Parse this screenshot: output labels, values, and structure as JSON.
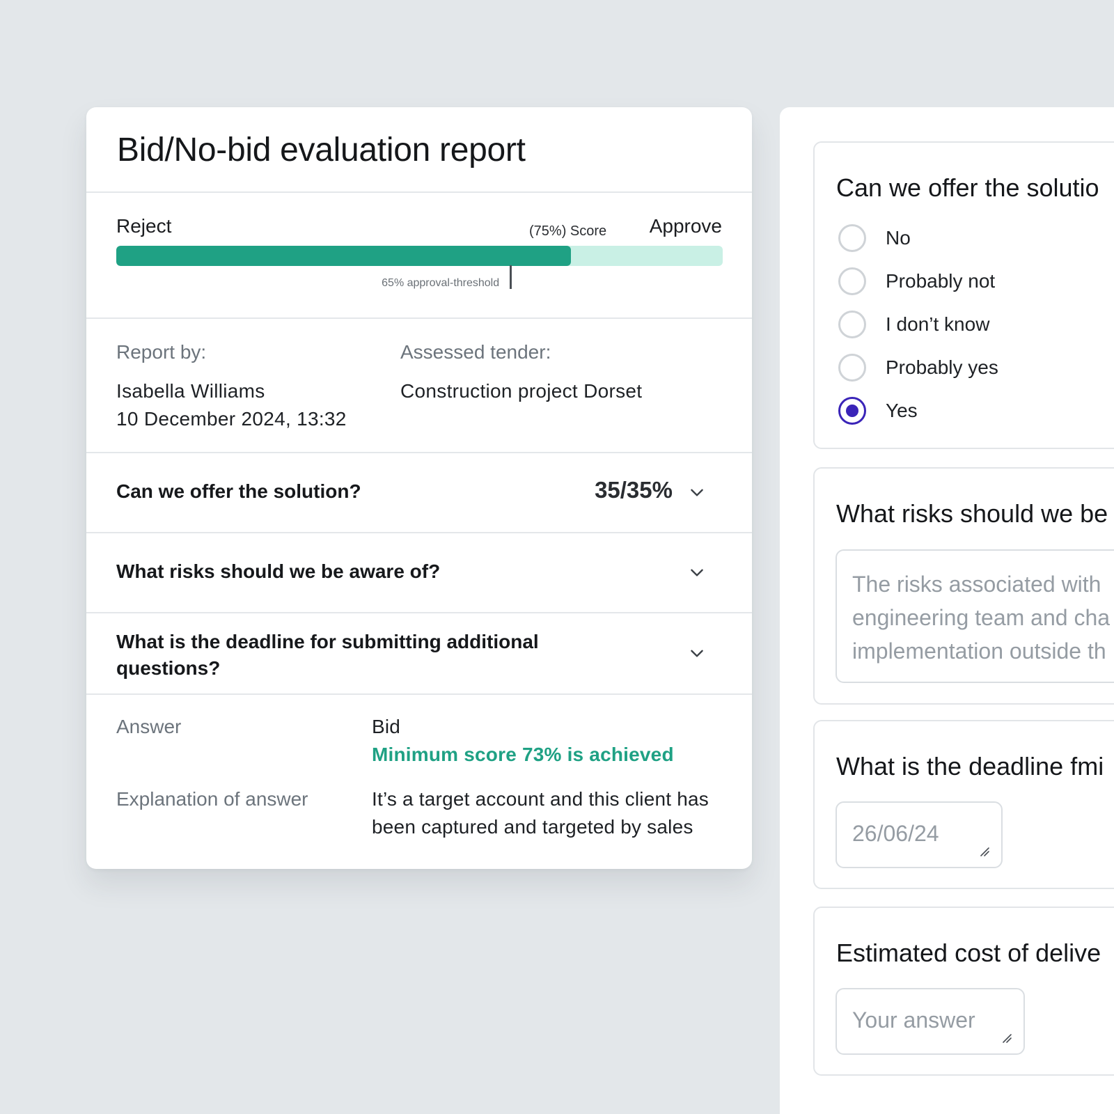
{
  "report": {
    "title": "Bid/No-bid evaluation report",
    "score_bar": {
      "reject_label": "Reject",
      "approve_label": "Approve",
      "score_label": "(75%) Score",
      "score_fraction": 0.75,
      "threshold_fraction": 0.65,
      "threshold_label": "65% approval-threshold",
      "fill_color": "#1fa184",
      "track_color": "#c9f0e5"
    },
    "meta": {
      "report_by_label": "Report by:",
      "report_by_name": "Isabella Williams",
      "report_date": "10 December 2024, 13:32",
      "tender_label": "Assessed tender:",
      "tender_value": "Construction project Dorset"
    },
    "questions": [
      {
        "text": "Can we offer the solution?",
        "score": "35/35%"
      },
      {
        "text": "What risks should we be aware of?",
        "score": ""
      },
      {
        "text": "What is the deadline for submitting additional questions?",
        "score": ""
      }
    ],
    "answer": {
      "answer_label": "Answer",
      "answer_value": "Bid",
      "answer_status": "Minimum score 73% is achieved",
      "explanation_label": "Explanation of answer",
      "explanation_value": "It’s a target account and this client has been captured and targeted by sales"
    }
  },
  "form": {
    "q1": {
      "title": "Can we offer the solutio",
      "options": [
        "No",
        "Probably not",
        "I don’t know",
        "Probably yes",
        "Yes"
      ],
      "selected": "Yes"
    },
    "q2": {
      "title": "What risks should we be",
      "text_lines": [
        "The risks associated with",
        "engineering team and cha",
        "implementation outside th"
      ]
    },
    "q3": {
      "title": "What is the deadline fmi",
      "value": "26/06/24"
    },
    "q4": {
      "title": "Estimated cost of delive",
      "placeholder": "Your answer"
    },
    "accent_color": "#3a24b8"
  }
}
